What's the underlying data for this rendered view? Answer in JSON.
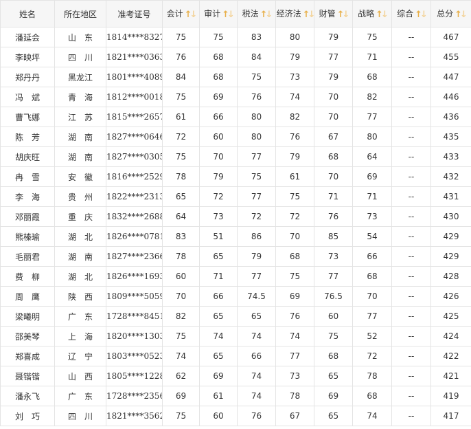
{
  "accent_color": "#e8b04a",
  "sort_icon_name": "sort-up-down-icon",
  "sort_icon_glyph_up": "↑",
  "sort_icon_glyph_down": "↓",
  "columns": [
    {
      "key": "name",
      "label": "姓名",
      "sortable": false
    },
    {
      "key": "region",
      "label": "所在地区",
      "sortable": false
    },
    {
      "key": "exam_id",
      "label": "准考证号",
      "sortable": false
    },
    {
      "key": "accounting",
      "label": "会计",
      "sortable": true
    },
    {
      "key": "audit",
      "label": "审计",
      "sortable": true
    },
    {
      "key": "tax",
      "label": "税法",
      "sortable": true
    },
    {
      "key": "economic_law",
      "label": "经济法",
      "sortable": true
    },
    {
      "key": "finance",
      "label": "财管",
      "sortable": true
    },
    {
      "key": "strategy",
      "label": "战略",
      "sortable": true
    },
    {
      "key": "comprehensive",
      "label": "综合",
      "sortable": true
    },
    {
      "key": "total",
      "label": "总分",
      "sortable": true
    }
  ],
  "rows": [
    {
      "name": "潘延会",
      "region": "山　东",
      "exam_id": "1814****8327",
      "accounting": "75",
      "audit": "75",
      "tax": "83",
      "economic_law": "80",
      "finance": "79",
      "strategy": "75",
      "comprehensive": "--",
      "total": "467"
    },
    {
      "name": "李映坪",
      "region": "四　川",
      "exam_id": "1821****0363",
      "accounting": "76",
      "audit": "68",
      "tax": "84",
      "economic_law": "79",
      "finance": "77",
      "strategy": "71",
      "comprehensive": "--",
      "total": "455"
    },
    {
      "name": "郑丹丹",
      "region": "黑龙江",
      "exam_id": "1801****4089",
      "accounting": "84",
      "audit": "68",
      "tax": "75",
      "economic_law": "73",
      "finance": "79",
      "strategy": "68",
      "comprehensive": "--",
      "total": "447"
    },
    {
      "name": "冯　斌",
      "region": "青　海",
      "exam_id": "1812****0018",
      "accounting": "75",
      "audit": "69",
      "tax": "76",
      "economic_law": "74",
      "finance": "70",
      "strategy": "82",
      "comprehensive": "--",
      "total": "446"
    },
    {
      "name": "曹飞娜",
      "region": "江　苏",
      "exam_id": "1815****2657",
      "accounting": "61",
      "audit": "66",
      "tax": "80",
      "economic_law": "82",
      "finance": "70",
      "strategy": "77",
      "comprehensive": "--",
      "total": "436"
    },
    {
      "name": "陈　芳",
      "region": "湖　南",
      "exam_id": "1827****0646",
      "accounting": "72",
      "audit": "60",
      "tax": "80",
      "economic_law": "76",
      "finance": "67",
      "strategy": "80",
      "comprehensive": "--",
      "total": "435"
    },
    {
      "name": "胡庆旺",
      "region": "湖　南",
      "exam_id": "1827****0305",
      "accounting": "75",
      "audit": "70",
      "tax": "77",
      "economic_law": "79",
      "finance": "68",
      "strategy": "64",
      "comprehensive": "--",
      "total": "433"
    },
    {
      "name": "冉　雪",
      "region": "安　徽",
      "exam_id": "1816****2529",
      "accounting": "78",
      "audit": "79",
      "tax": "75",
      "economic_law": "61",
      "finance": "70",
      "strategy": "69",
      "comprehensive": "--",
      "total": "432"
    },
    {
      "name": "李　海",
      "region": "贵　州",
      "exam_id": "1822****2313",
      "accounting": "65",
      "audit": "72",
      "tax": "77",
      "economic_law": "75",
      "finance": "71",
      "strategy": "71",
      "comprehensive": "--",
      "total": "431"
    },
    {
      "name": "邓丽霞",
      "region": "重　庆",
      "exam_id": "1832****2688",
      "accounting": "64",
      "audit": "73",
      "tax": "72",
      "economic_law": "72",
      "finance": "76",
      "strategy": "73",
      "comprehensive": "--",
      "total": "430"
    },
    {
      "name": "熊榛瑜",
      "region": "湖　北",
      "exam_id": "1826****0781",
      "accounting": "83",
      "audit": "51",
      "tax": "86",
      "economic_law": "70",
      "finance": "85",
      "strategy": "54",
      "comprehensive": "--",
      "total": "429"
    },
    {
      "name": "毛丽君",
      "region": "湖　南",
      "exam_id": "1827****2366",
      "accounting": "78",
      "audit": "65",
      "tax": "79",
      "economic_law": "68",
      "finance": "73",
      "strategy": "66",
      "comprehensive": "--",
      "total": "429"
    },
    {
      "name": "费　柳",
      "region": "湖　北",
      "exam_id": "1826****1693",
      "accounting": "60",
      "audit": "71",
      "tax": "77",
      "economic_law": "75",
      "finance": "77",
      "strategy": "68",
      "comprehensive": "--",
      "total": "428"
    },
    {
      "name": "周　鹰",
      "region": "陕　西",
      "exam_id": "1809****5059",
      "accounting": "70",
      "audit": "66",
      "tax": "74.5",
      "economic_law": "69",
      "finance": "76.5",
      "strategy": "70",
      "comprehensive": "--",
      "total": "426"
    },
    {
      "name": "梁曦明",
      "region": "广　东",
      "exam_id": "1728****8451",
      "accounting": "82",
      "audit": "65",
      "tax": "65",
      "economic_law": "76",
      "finance": "60",
      "strategy": "77",
      "comprehensive": "--",
      "total": "425"
    },
    {
      "name": "邵美琴",
      "region": "上　海",
      "exam_id": "1820****1303",
      "accounting": "75",
      "audit": "74",
      "tax": "74",
      "economic_law": "74",
      "finance": "75",
      "strategy": "52",
      "comprehensive": "--",
      "total": "424"
    },
    {
      "name": "郑喜成",
      "region": "辽　宁",
      "exam_id": "1803****0523",
      "accounting": "74",
      "audit": "65",
      "tax": "66",
      "economic_law": "77",
      "finance": "68",
      "strategy": "72",
      "comprehensive": "--",
      "total": "422"
    },
    {
      "name": "聂锴锴",
      "region": "山　西",
      "exam_id": "1805****1228",
      "accounting": "62",
      "audit": "69",
      "tax": "74",
      "economic_law": "73",
      "finance": "65",
      "strategy": "78",
      "comprehensive": "--",
      "total": "421"
    },
    {
      "name": "潘永飞",
      "region": "广　东",
      "exam_id": "1728****2356",
      "accounting": "69",
      "audit": "61",
      "tax": "74",
      "economic_law": "78",
      "finance": "69",
      "strategy": "68",
      "comprehensive": "--",
      "total": "419"
    },
    {
      "name": "刘　巧",
      "region": "四　川",
      "exam_id": "1821****3562",
      "accounting": "75",
      "audit": "60",
      "tax": "76",
      "economic_law": "67",
      "finance": "65",
      "strategy": "74",
      "comprehensive": "--",
      "total": "417"
    }
  ]
}
